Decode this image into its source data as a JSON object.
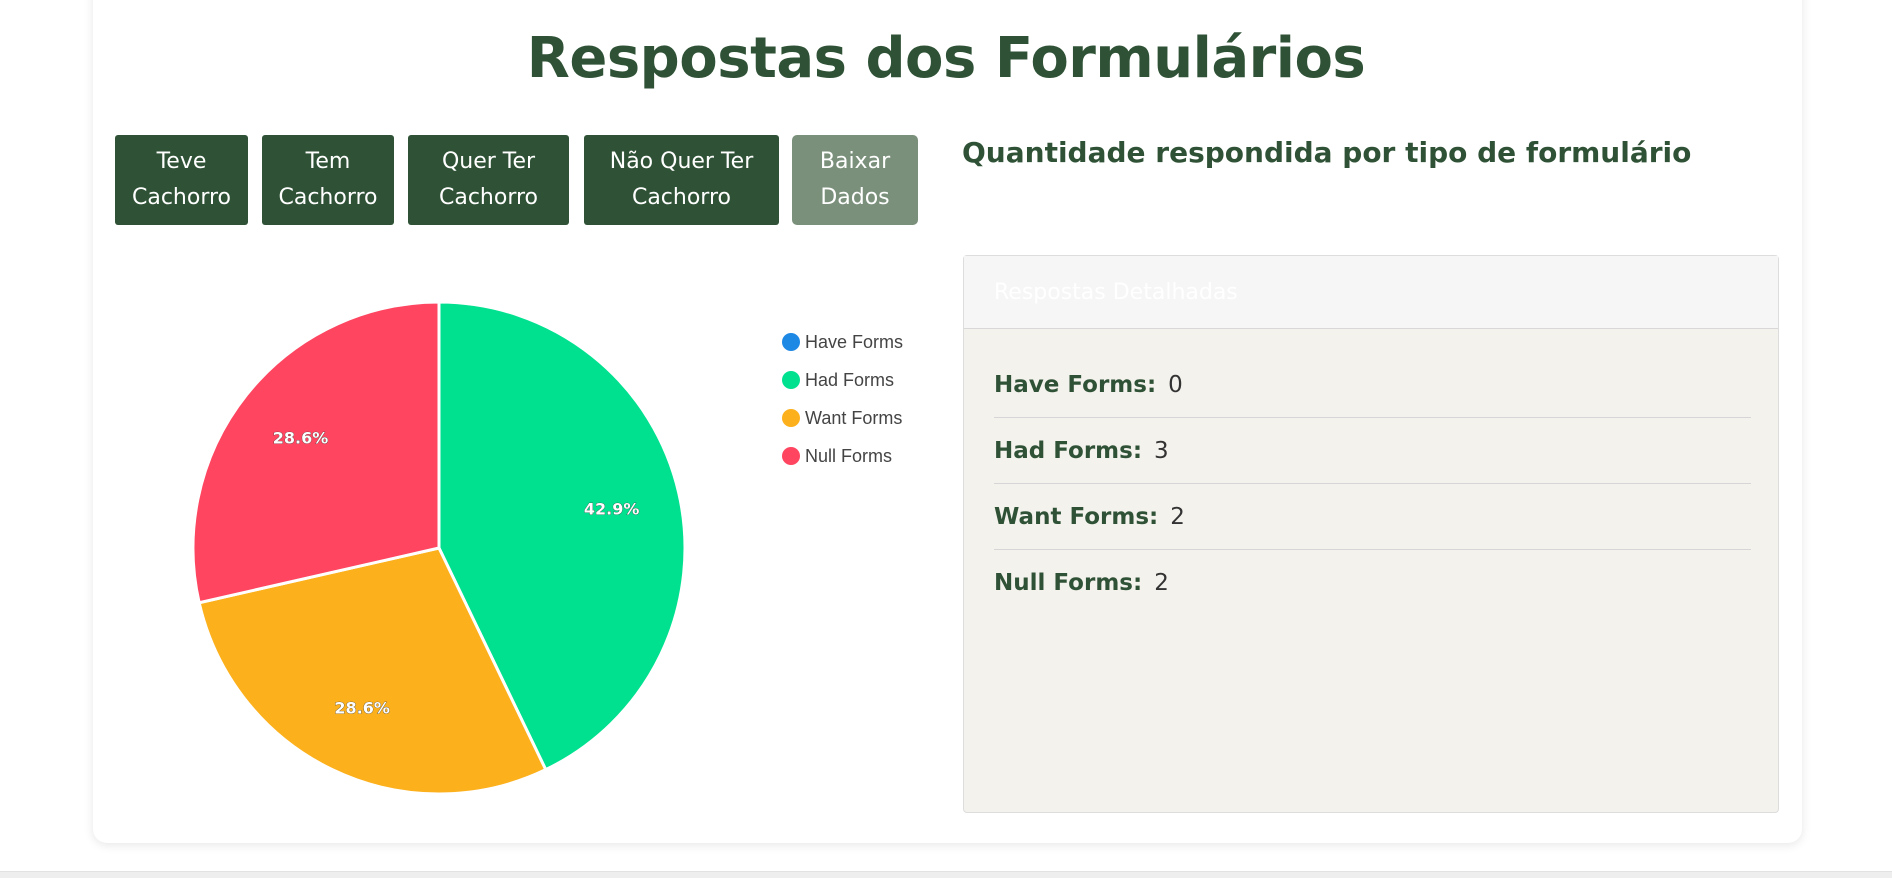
{
  "page_title": "Respostas dos Formulários",
  "buttons": [
    {
      "label_line1": "Teve",
      "label_line2": "Cachorro"
    },
    {
      "label_line1": "Tem",
      "label_line2": "Cachorro"
    },
    {
      "label_line1": "Quer Ter",
      "label_line2": "Cachorro"
    },
    {
      "label_line1": "Não Quer Ter",
      "label_line2": "Cachorro"
    },
    {
      "label_line1": "Baixar",
      "label_line2": "Dados"
    }
  ],
  "section_title": "Quantidade respondida por tipo de formulário",
  "panel": {
    "header": "Respostas Detalhadas",
    "rows": [
      {
        "label": "Have Forms:",
        "value": "0"
      },
      {
        "label": "Had Forms:",
        "value": "3"
      },
      {
        "label": "Want Forms:",
        "value": "2"
      },
      {
        "label": "Null Forms:",
        "value": "2"
      }
    ]
  },
  "colors": {
    "primary": "#2f5236",
    "secondary_button": "#7a907b",
    "have": "#1e88e5",
    "had": "#00e190",
    "want": "#fcb01c",
    "null": "#ff4560"
  },
  "chart_data": {
    "type": "pie",
    "categories": [
      "Have Forms",
      "Had Forms",
      "Want Forms",
      "Null Forms"
    ],
    "values": [
      0,
      3,
      2,
      2
    ],
    "labels": [
      "0%",
      "42.9%",
      "28.6%",
      "28.6%"
    ],
    "colors": [
      "#1e88e5",
      "#00e190",
      "#fcb01c",
      "#ff4560"
    ],
    "legend_position": "right"
  }
}
